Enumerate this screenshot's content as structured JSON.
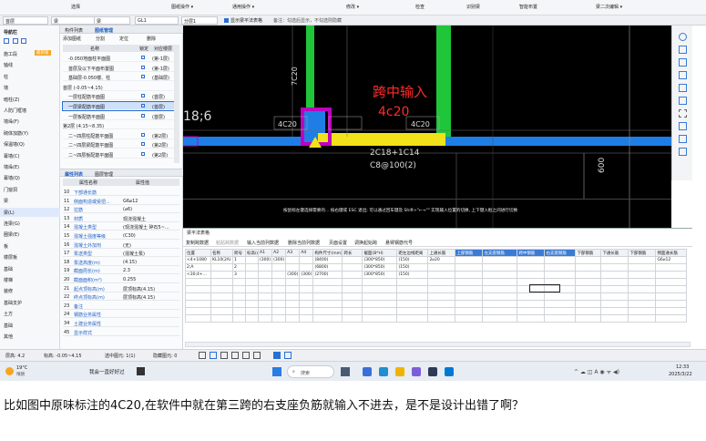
{
  "top_menu": {
    "select": "选择",
    "draw_ops": "图纸操作 ▾",
    "common_ops": "通用操作 ▾",
    "modify": "修改 ▾",
    "check": "检查",
    "recognize": "识别梁",
    "smart_layout": "智能布置",
    "beam_secondary": "梁二次编辑 ▾"
  },
  "toolbar": {
    "floor": "首层",
    "category": "梁",
    "type": "梁",
    "element": "GL1",
    "layer": "分层1",
    "show_original": "显示梁平法表格",
    "hint": "备注：勾选后显示，不勾选则隐藏"
  },
  "left_nav": {
    "header": "导航栏",
    "items": [
      "施工段",
      "轴线",
      "柱",
      "墙",
      "暗柱(Z)",
      "人防门框墙",
      "墙垛(F)",
      "砌体加筋(Y)",
      "保温墙(Q)",
      "幕墙(C)",
      "墙垛(E)",
      "幕墙(Q)",
      "门窗洞",
      "梁",
      "梁(L)",
      "连梁(G)",
      "圈梁(E)",
      "板",
      "楼层板",
      "基础",
      "楼梯",
      "装修",
      "基础支护",
      "土方",
      "基础",
      "其他"
    ],
    "tag_new": "最新版"
  },
  "layer_panel": {
    "tab1": "构件列表",
    "tab2": "图纸管理",
    "tools": [
      "添加图纸",
      "分割",
      "定位",
      "删除"
    ],
    "col_name": "名称",
    "col_lock": "锁定",
    "col_floor": "对应楼层",
    "rows": [
      {
        "name": "-0.050地面柱平面图",
        "floor": "(第-1层)"
      },
      {
        "name": "首层及以下平面布置图",
        "floor": "(第-1层)"
      },
      {
        "name": "基础层-0.050楼、柱",
        "floor": "(基础层)"
      },
      {
        "name": "首层 (-0.05~4.15)",
        "floor": ""
      },
      {
        "name": "一层柱配筋平面图",
        "floor": "(首层)"
      },
      {
        "name": "一层梁配筋平面图",
        "floor": "(首层)"
      },
      {
        "name": "一层板配筋平面图",
        "floor": "(首层)"
      },
      {
        "name": "第2层 (4.15~8.35)",
        "floor": ""
      },
      {
        "name": "二~四层柱配筋平面图",
        "floor": "(第2层)"
      },
      {
        "name": "二~四层梁配筋平面图",
        "floor": "(第2层)"
      },
      {
        "name": "二~四层板配筋平面图",
        "floor": "(第2层)"
      }
    ]
  },
  "props": {
    "tab1": "属性列表",
    "tab2": "图层管理",
    "col_name": "属性名称",
    "col_val": "属性值",
    "rows": [
      {
        "n": "10",
        "name": "下部通长筋",
        "val": ""
      },
      {
        "n": "11",
        "name": "侧面构造或受扭...",
        "val": "G6⌀12"
      },
      {
        "n": "12",
        "name": "拉筋",
        "val": "(⌀6)"
      },
      {
        "n": "13",
        "name": "材质",
        "val": "现浇混凝土"
      },
      {
        "n": "14",
        "name": "混凝土类型",
        "val": "(现浇混凝土 碎石5~..."
      },
      {
        "n": "15",
        "name": "混凝土强度等级",
        "val": "(C30)"
      },
      {
        "n": "16",
        "name": "混凝土外加剂",
        "val": "(无)"
      },
      {
        "n": "17",
        "name": "泵送类型",
        "val": "(混凝土泵)"
      },
      {
        "n": "18",
        "name": "泵送高度(m)",
        "val": "(4.15)"
      },
      {
        "n": "19",
        "name": "截面周长(m)",
        "val": "2.3"
      },
      {
        "n": "20",
        "name": "截面面积(m²)",
        "val": "0.255"
      },
      {
        "n": "21",
        "name": "起点顶标高(m)",
        "val": "层顶标高(4.15)"
      },
      {
        "n": "22",
        "name": "终点顶标高(m)",
        "val": "层顶标高(4.15)"
      },
      {
        "n": "23",
        "name": "备注",
        "val": ""
      },
      {
        "n": "24",
        "name": "钢筋业务属性",
        "val": ""
      },
      {
        "n": "34",
        "name": "土建业务属性",
        "val": ""
      },
      {
        "n": "45",
        "name": "显示样式",
        "val": ""
      }
    ]
  },
  "canvas": {
    "red_text": "跨中输入",
    "red_value": "4c20",
    "label_18": "18;6",
    "label_4c20a": "4C20",
    "label_4c20b": "4C20",
    "label_7c20": "7C20",
    "label_2c18": "2C18+1C14",
    "label_c8": "C8@100(2)",
    "label_600": "600",
    "status_hint": "按鼠标左键选择需要的...  按右键或 ESC 退出; 可以通过回车键及 Shift+\"←→\"\" 实现输入位置的切换, 上下键入框之间进行切换"
  },
  "bottom_table": {
    "title": "梁平法表格",
    "toolbar": [
      "复制跨数据",
      "粘贴跨数据",
      "输入当前列数据",
      "删除当前列数据",
      "页面设置",
      "调换起始跨",
      "悬臂钢筋代号"
    ],
    "headers": [
      "位置",
      "名称",
      "跨号",
      "标高(m)",
      "A1",
      "A2",
      "A3",
      "A4",
      "构件尺寸(mm)",
      "跨长",
      "截面(B*H)",
      "距左边线距离",
      "上通长筋",
      "上部钢筋",
      "左支座钢筋",
      "跨中钢筋",
      "右支座钢筋",
      "下部钢筋",
      "下通长筋",
      "下部钢筋",
      "侧面通长筋"
    ],
    "rows": [
      [
        "<4+1080",
        "KL10(2A)",
        "1",
        "",
        "(300)",
        "(300)",
        "",
        "",
        "(8400)",
        "",
        "(300*850)",
        "(150)",
        "2⌀20",
        "",
        "",
        "",
        "",
        "",
        "",
        "",
        "G6⌀12"
      ],
      [
        "2;A",
        "",
        "2",
        "",
        "",
        "",
        "",
        "",
        "(6800)",
        "",
        "(300*850)",
        "(150)",
        "",
        "",
        "",
        "",
        "",
        "",
        "",
        "",
        ""
      ],
      [
        "<30;4+...",
        "",
        "3",
        "",
        "",
        "",
        "(300)",
        "(300)",
        "(2700)",
        "",
        "(300*850)",
        "(150)",
        "",
        "",
        "",
        "",
        "",
        "",
        "",
        "",
        ""
      ]
    ]
  },
  "status": {
    "floor_h": "层高: 4.2",
    "elevation": "标高: -0.05~4.15",
    "selected": "选中图元: 1(1)",
    "hidden": "隐藏图元: 0"
  },
  "taskbar": {
    "weather_temp": "19°C",
    "weather_desc": "晴朗",
    "app_title": "我会一直好好过",
    "search": "搜索",
    "time": "12:33",
    "date": "2025/3/22"
  },
  "caption": "比如图中原味标注的4C20,在软件中就在第三跨的右支座负筋就输入不进去，是不是设计出错了啊？",
  "colors": {
    "green": "#1fc63a",
    "blue": "#1e7ee6",
    "yellow": "#f2e21a",
    "red": "#ff2a2a",
    "magenta": "#c000c0"
  }
}
